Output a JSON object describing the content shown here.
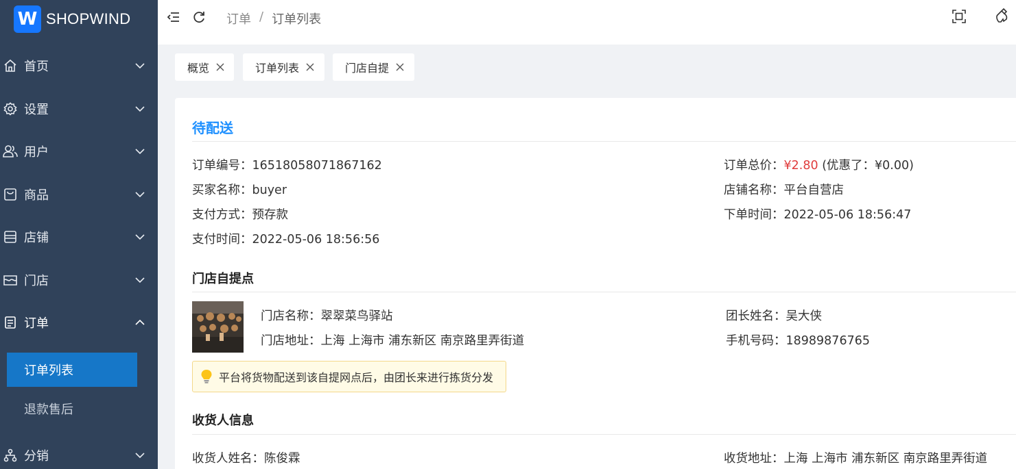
{
  "brand": {
    "logo_letter": "W",
    "name": "SHOPWIND",
    "accent": "#1677ff"
  },
  "sidebar": {
    "items": [
      {
        "label": "首页",
        "icon": "home-icon"
      },
      {
        "label": "设置",
        "icon": "gear-icon"
      },
      {
        "label": "用户",
        "icon": "users-icon"
      },
      {
        "label": "商品",
        "icon": "bag-icon"
      },
      {
        "label": "店铺",
        "icon": "store-icon"
      },
      {
        "label": "门店",
        "icon": "shop-icon"
      },
      {
        "label": "订单",
        "icon": "document-icon",
        "expanded": true
      },
      {
        "label": "分销",
        "icon": "network-icon"
      }
    ],
    "submenu": [
      {
        "label": "订单列表",
        "active": true
      },
      {
        "label": "退款售后",
        "active": false
      }
    ]
  },
  "header": {
    "breadcrumb": [
      "订单",
      "订单列表"
    ],
    "separator": "/"
  },
  "tabs": [
    {
      "label": "概览"
    },
    {
      "label": "订单列表"
    },
    {
      "label": "门店自提"
    }
  ],
  "order": {
    "status": "待配送",
    "left": [
      {
        "key": "订单编号：",
        "value": "16518058071867162"
      },
      {
        "key": "买家名称：",
        "value": "buyer"
      },
      {
        "key": "支付方式：",
        "value": "预存款"
      },
      {
        "key": "支付时间：",
        "value": "2022-05-06 18:56:56"
      }
    ],
    "total_key": "订单总价：",
    "total_price": "¥2.80",
    "discount": "(优惠了：¥0.00)",
    "right": [
      {
        "key": "店铺名称：",
        "value": "平台自营店"
      },
      {
        "key": "下单时间：",
        "value": "2022-05-06 18:56:47"
      }
    ]
  },
  "pickup": {
    "title": "门店自提点",
    "store_name_key": "门店名称：",
    "store_name": "翠翠菜鸟驿站",
    "store_addr_key": "门店地址：",
    "store_addr": "上海 上海市 浦东新区 南京路里弄街道",
    "leader_key": "团长姓名：",
    "leader": "吴大侠",
    "phone_key": "手机号码：",
    "phone": "18989876765",
    "tip": "平台将货物配送到该自提网点后，由团长来进行拣货分发"
  },
  "consignee": {
    "title": "收货人信息",
    "name_key": "收货人姓名：",
    "name": "陈俊霖",
    "addr_key": "收货地址：",
    "addr": "上海 上海市 浦东新区 南京路里弄街道"
  }
}
